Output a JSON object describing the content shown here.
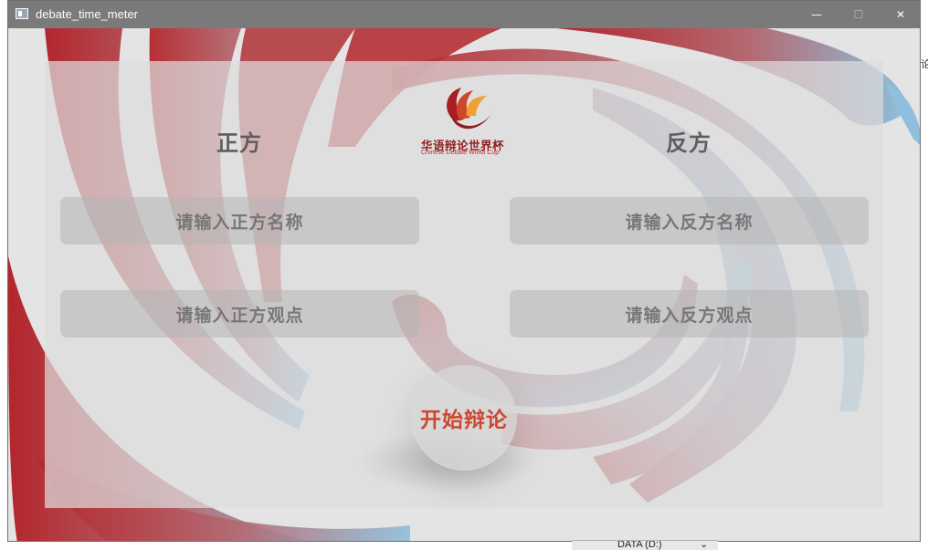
{
  "window": {
    "title": "debate_time_meter",
    "minimize_symbol": "—",
    "maximize_symbol": "☐",
    "close_symbol": "✕"
  },
  "logo": {
    "chinese": "华语辩论世界杯",
    "english": "Chinese Debate World Cup"
  },
  "pro": {
    "title": "正方",
    "name_placeholder": "请输入正方名称",
    "view_placeholder": "请输入正方观点"
  },
  "con": {
    "title": "反方",
    "name_placeholder": "请输入反方名称",
    "view_placeholder": "请输入反方观点"
  },
  "start_button": {
    "label": "开始辩论"
  },
  "background": {
    "edge_fragment": "论",
    "taskbar_label": "DATA (D:)",
    "taskbar_chevron": "⌄"
  },
  "colors": {
    "red": "#b62a2f",
    "blue": "#8fbfdc",
    "panel": "#dcdcdc",
    "start_text": "#cf4630",
    "title_bar": "#7a7a7a"
  }
}
